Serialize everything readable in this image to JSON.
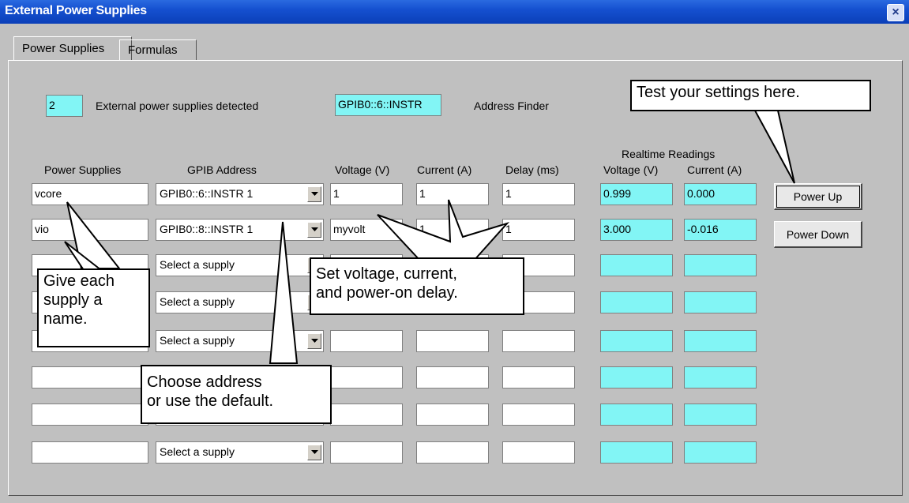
{
  "window": {
    "title": "External Power Supplies",
    "close_glyph": "×"
  },
  "tabs": [
    {
      "label": "Power Supplies"
    },
    {
      "label": "Formulas"
    }
  ],
  "detected": {
    "count": "2",
    "label": "External power supplies detected"
  },
  "address_finder": {
    "value": "GPIB0::6::INSTR",
    "label": "Address Finder"
  },
  "headers": {
    "power_supplies": "Power Supplies",
    "gpib_address": "GPIB Address",
    "voltage": "Voltage (V)",
    "current": "Current (A)",
    "delay": "Delay (ms)",
    "realtime": "Realtime Readings",
    "rt_voltage": "Voltage (V)",
    "rt_current": "Current (A)"
  },
  "rows": [
    {
      "name": "vcore",
      "address": "GPIB0::6::INSTR  1",
      "voltage": "1",
      "current": "1",
      "delay": "1",
      "rt_voltage": "0.999",
      "rt_current": "0.000"
    },
    {
      "name": "vio",
      "address": "GPIB0::8::INSTR  1",
      "voltage": "myvolt",
      "current": "1",
      "delay": "1",
      "rt_voltage": "3.000",
      "rt_current": "-0.016"
    },
    {
      "name": "",
      "address": "Select a supply",
      "voltage": "",
      "current": "",
      "delay": "",
      "rt_voltage": "",
      "rt_current": ""
    },
    {
      "name": "",
      "address": "Select a supply",
      "voltage": "",
      "current": "",
      "delay": "",
      "rt_voltage": "",
      "rt_current": ""
    },
    {
      "name": "",
      "address": "Select a supply",
      "voltage": "",
      "current": "",
      "delay": "",
      "rt_voltage": "",
      "rt_current": ""
    },
    {
      "name": "",
      "address": "",
      "voltage": "",
      "current": "",
      "delay": "",
      "rt_voltage": "",
      "rt_current": ""
    },
    {
      "name": "",
      "address": "",
      "voltage": "",
      "current": "",
      "delay": "",
      "rt_voltage": "",
      "rt_current": ""
    },
    {
      "name": "",
      "address": "Select a supply",
      "voltage": "",
      "current": "",
      "delay": "",
      "rt_voltage": "",
      "rt_current": ""
    }
  ],
  "buttons": {
    "power_up": "Power Up",
    "power_down": "Power Down"
  },
  "callouts": {
    "test": "Test your settings here.",
    "name_line1": "Give each",
    "name_line2": "supply a",
    "name_line3": "name.",
    "voltage_line1": "Set voltage, current,",
    "voltage_line2": "and power-on delay.",
    "address_line1": "Choose address",
    "address_line2": "or use the default."
  },
  "colors": {
    "title_bar": "#0b3fb8",
    "reading_field": "#82f5f5",
    "address_finder_field": "#82f5f5"
  }
}
